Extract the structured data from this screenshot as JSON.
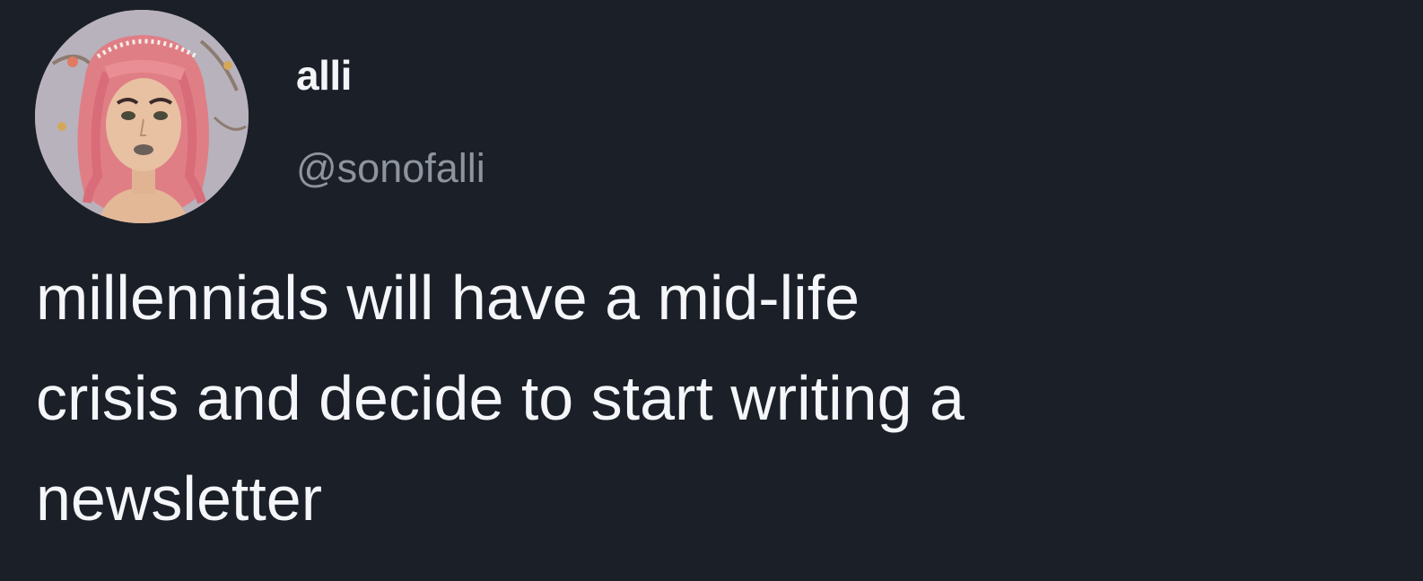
{
  "theme": {
    "background": "#1b1f28",
    "text_primary": "#f4f6f9",
    "text_secondary": "#8d949d"
  },
  "author": {
    "display_name": "alli",
    "handle": "@sonofalli",
    "avatar_icon": "profile-avatar"
  },
  "tweet": {
    "lines": [
      "millennials will have a mid-life",
      "crisis and decide to start writing a",
      "newsletter"
    ]
  }
}
